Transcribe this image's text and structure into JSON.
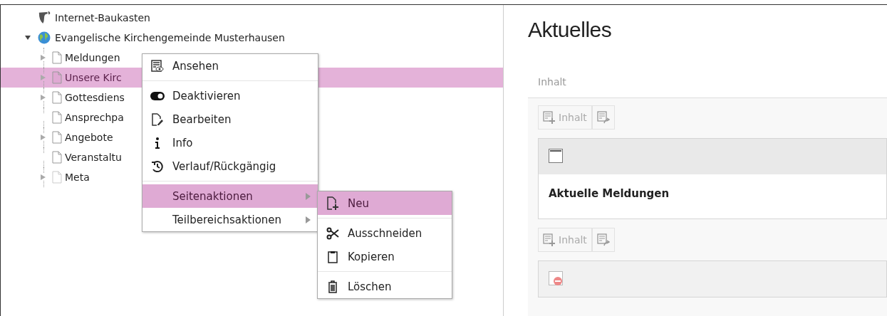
{
  "page_tree": {
    "root": {
      "label": "Internet-Baukasten"
    },
    "items": [
      {
        "label": "Evangelische Kirchengemeinde Musterhausen",
        "kind": "site",
        "expanded": true,
        "selected": false,
        "children": [
          {
            "label": "Meldungen",
            "kind": "page",
            "has_children": true,
            "hidden": false,
            "selected": false
          },
          {
            "label": "Unsere Kirc",
            "kind": "page",
            "has_children": true,
            "hidden": false,
            "selected": true
          },
          {
            "label": "Gottesdiens",
            "kind": "page",
            "has_children": true,
            "hidden": false,
            "selected": false
          },
          {
            "label": "Ansprechpa",
            "kind": "page",
            "has_children": false,
            "hidden": false,
            "selected": false
          },
          {
            "label": "Angebote",
            "kind": "page",
            "has_children": true,
            "hidden": false,
            "selected": false
          },
          {
            "label": "Veranstaltu",
            "kind": "page",
            "has_children": false,
            "hidden": false,
            "selected": false
          },
          {
            "label": "Meta",
            "kind": "page",
            "has_children": true,
            "hidden": true,
            "selected": false
          }
        ]
      }
    ]
  },
  "context_menu": {
    "groups": [
      [
        {
          "label": "Ansehen",
          "submenu": false,
          "selected": false
        }
      ],
      [
        {
          "label": "Deaktivieren",
          "submenu": false,
          "selected": false
        },
        {
          "label": "Bearbeiten",
          "submenu": false,
          "selected": false
        },
        {
          "label": "Info",
          "submenu": false,
          "selected": false
        },
        {
          "label": "Verlauf/Rückgängig",
          "submenu": false,
          "selected": false
        }
      ],
      [
        {
          "label": "Seitenaktionen",
          "submenu": true,
          "selected": true
        },
        {
          "label": "Teilbereichsaktionen",
          "submenu": true,
          "selected": false
        }
      ]
    ]
  },
  "submenu": {
    "groups": [
      [
        {
          "label": "Neu",
          "selected": true
        }
      ],
      [
        {
          "label": "Ausschneiden",
          "selected": false
        },
        {
          "label": "Kopieren",
          "selected": false
        }
      ],
      [
        {
          "label": "Löschen",
          "selected": false
        }
      ]
    ]
  },
  "content": {
    "title": "Aktuelles",
    "column_header": "Inhalt",
    "new_content_buttons": [
      {
        "label": "Inhalt"
      },
      {
        "label": "Inhalt"
      }
    ],
    "elements": [
      {
        "header": "Aktuelle Meldungen",
        "hidden": false
      },
      {
        "hidden": true
      }
    ]
  }
}
